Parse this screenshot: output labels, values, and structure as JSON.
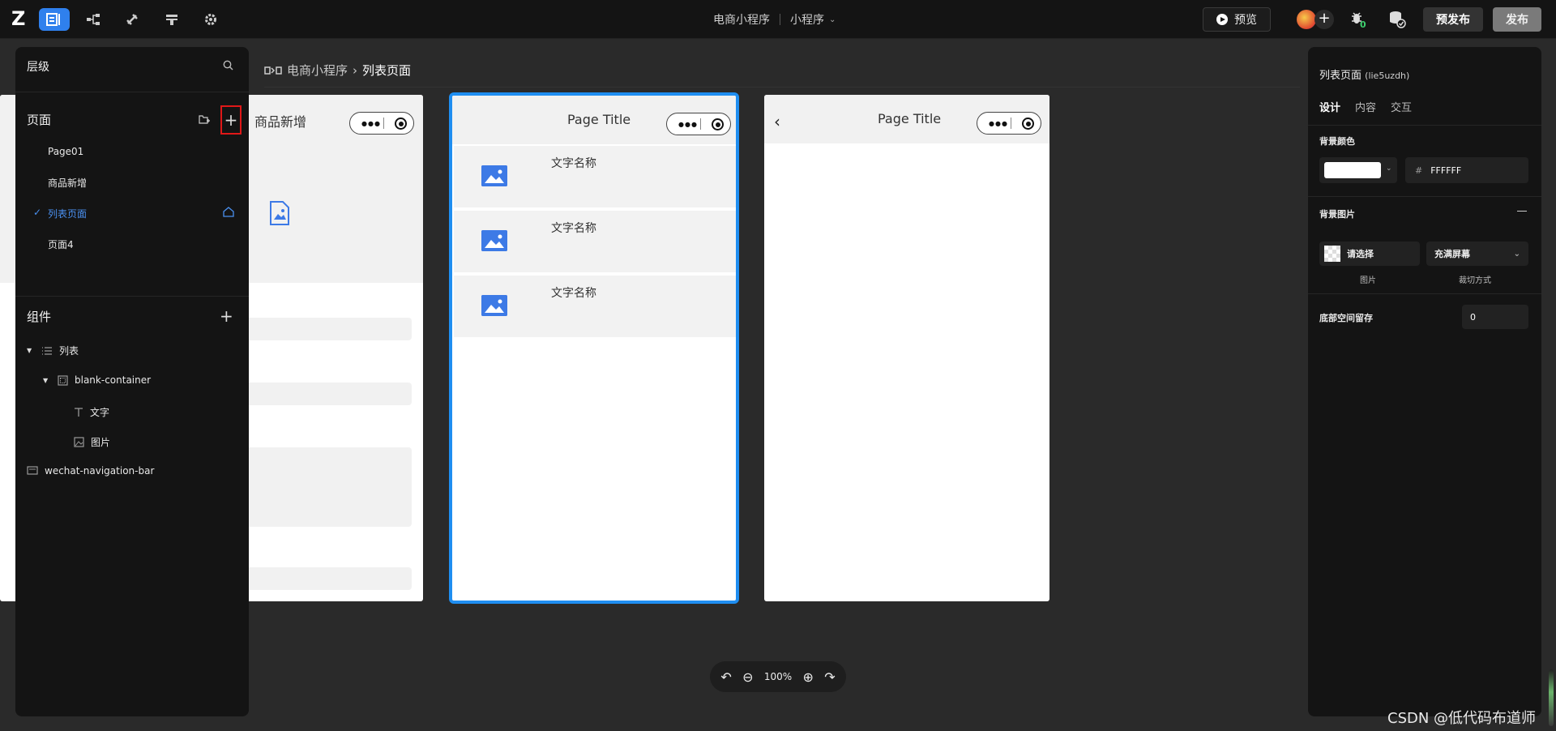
{
  "topbar": {
    "logo": "Z",
    "app_name": "电商小程序",
    "platform": "小程序",
    "preview": "预览",
    "prepublish": "预发布",
    "publish": "发布"
  },
  "left": {
    "layers_title": "层级",
    "pages_title": "页面",
    "pages": [
      "Page01",
      "商品新增",
      "列表页面",
      "页面4"
    ],
    "components_title": "组件",
    "tree": {
      "list": "列表",
      "container": "blank-container",
      "text": "文字",
      "image": "图片",
      "navbar": "wechat-navigation-bar"
    }
  },
  "canvas": {
    "breadcrumb_root": "电商小程序",
    "breadcrumb_sep": "›",
    "breadcrumb_current": "列表页面",
    "phone1_title": "商品新增",
    "phone2_title": "Page Title",
    "phone3_title": "Page Title",
    "list_items": [
      "文字名称",
      "文字名称",
      "文字名称"
    ],
    "zoom": "100%"
  },
  "right": {
    "title": "列表页面",
    "id": "(lie5uzdh)",
    "tabs": [
      "设计",
      "内容",
      "交互"
    ],
    "bg_color_label": "背景颜色",
    "bg_color_hex": "FFFFFF",
    "bg_image_label": "背景图片",
    "image_select": "请选择",
    "fill_mode": "充满屏幕",
    "image_sublabel": "图片",
    "crop_sublabel": "裁切方式",
    "bottom_space_label": "底部空间留存",
    "bottom_space_value": "0"
  },
  "watermark": "CSDN @低代码布道师",
  "colors": {
    "accent": "#2f80ed",
    "highlight_border": "#e01818",
    "image_blue": "#3d7ae6"
  }
}
